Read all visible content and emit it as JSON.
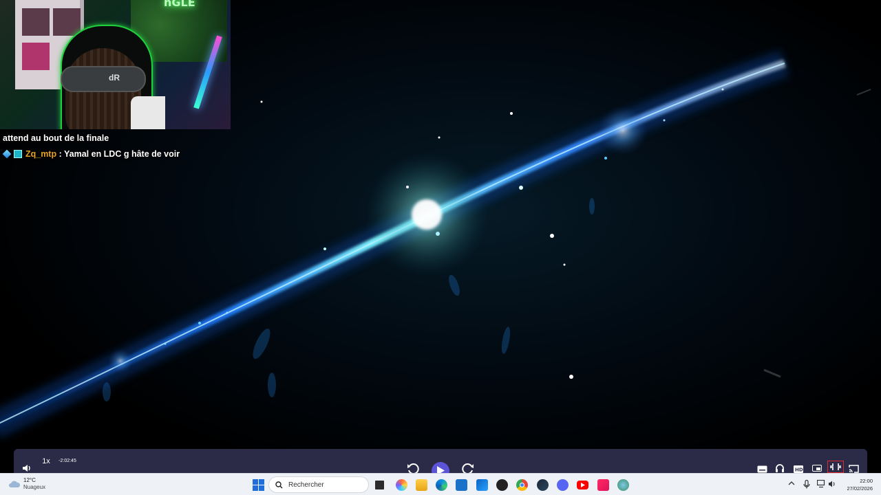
{
  "chat": {
    "line1_text": "attend au bout de la finale",
    "line2_user": "Zq_mtp",
    "line2_sep": " : ",
    "line2_text": "Yamal en LDC g hâte de voir"
  },
  "webcam": {
    "neon_sign": "nGLE",
    "headset_logo": "dR"
  },
  "player": {
    "speed": "1x",
    "time_remaining": "-2:02:45",
    "accent_color": "#5b54d9",
    "buttons": [
      "volume-icon",
      "rewind-icon",
      "play-icon",
      "forward-icon",
      "subtitles-icon",
      "audio-icon",
      "hd-icon",
      "pip-icon",
      "exit-fullscreen-icon",
      "cast-icon"
    ]
  },
  "taskbar": {
    "weather_temp": "12°C",
    "weather_desc": "Nuageux",
    "search_placeholder": "Rechercher",
    "time": "22:00",
    "date": "27/02/2026",
    "apps": [
      "windows-start",
      "search",
      "task-view",
      "copilot",
      "file-explorer",
      "edge",
      "store",
      "outlook",
      "obs",
      "chrome",
      "steam",
      "discord",
      "youtube",
      "tiktok",
      "globe"
    ]
  }
}
